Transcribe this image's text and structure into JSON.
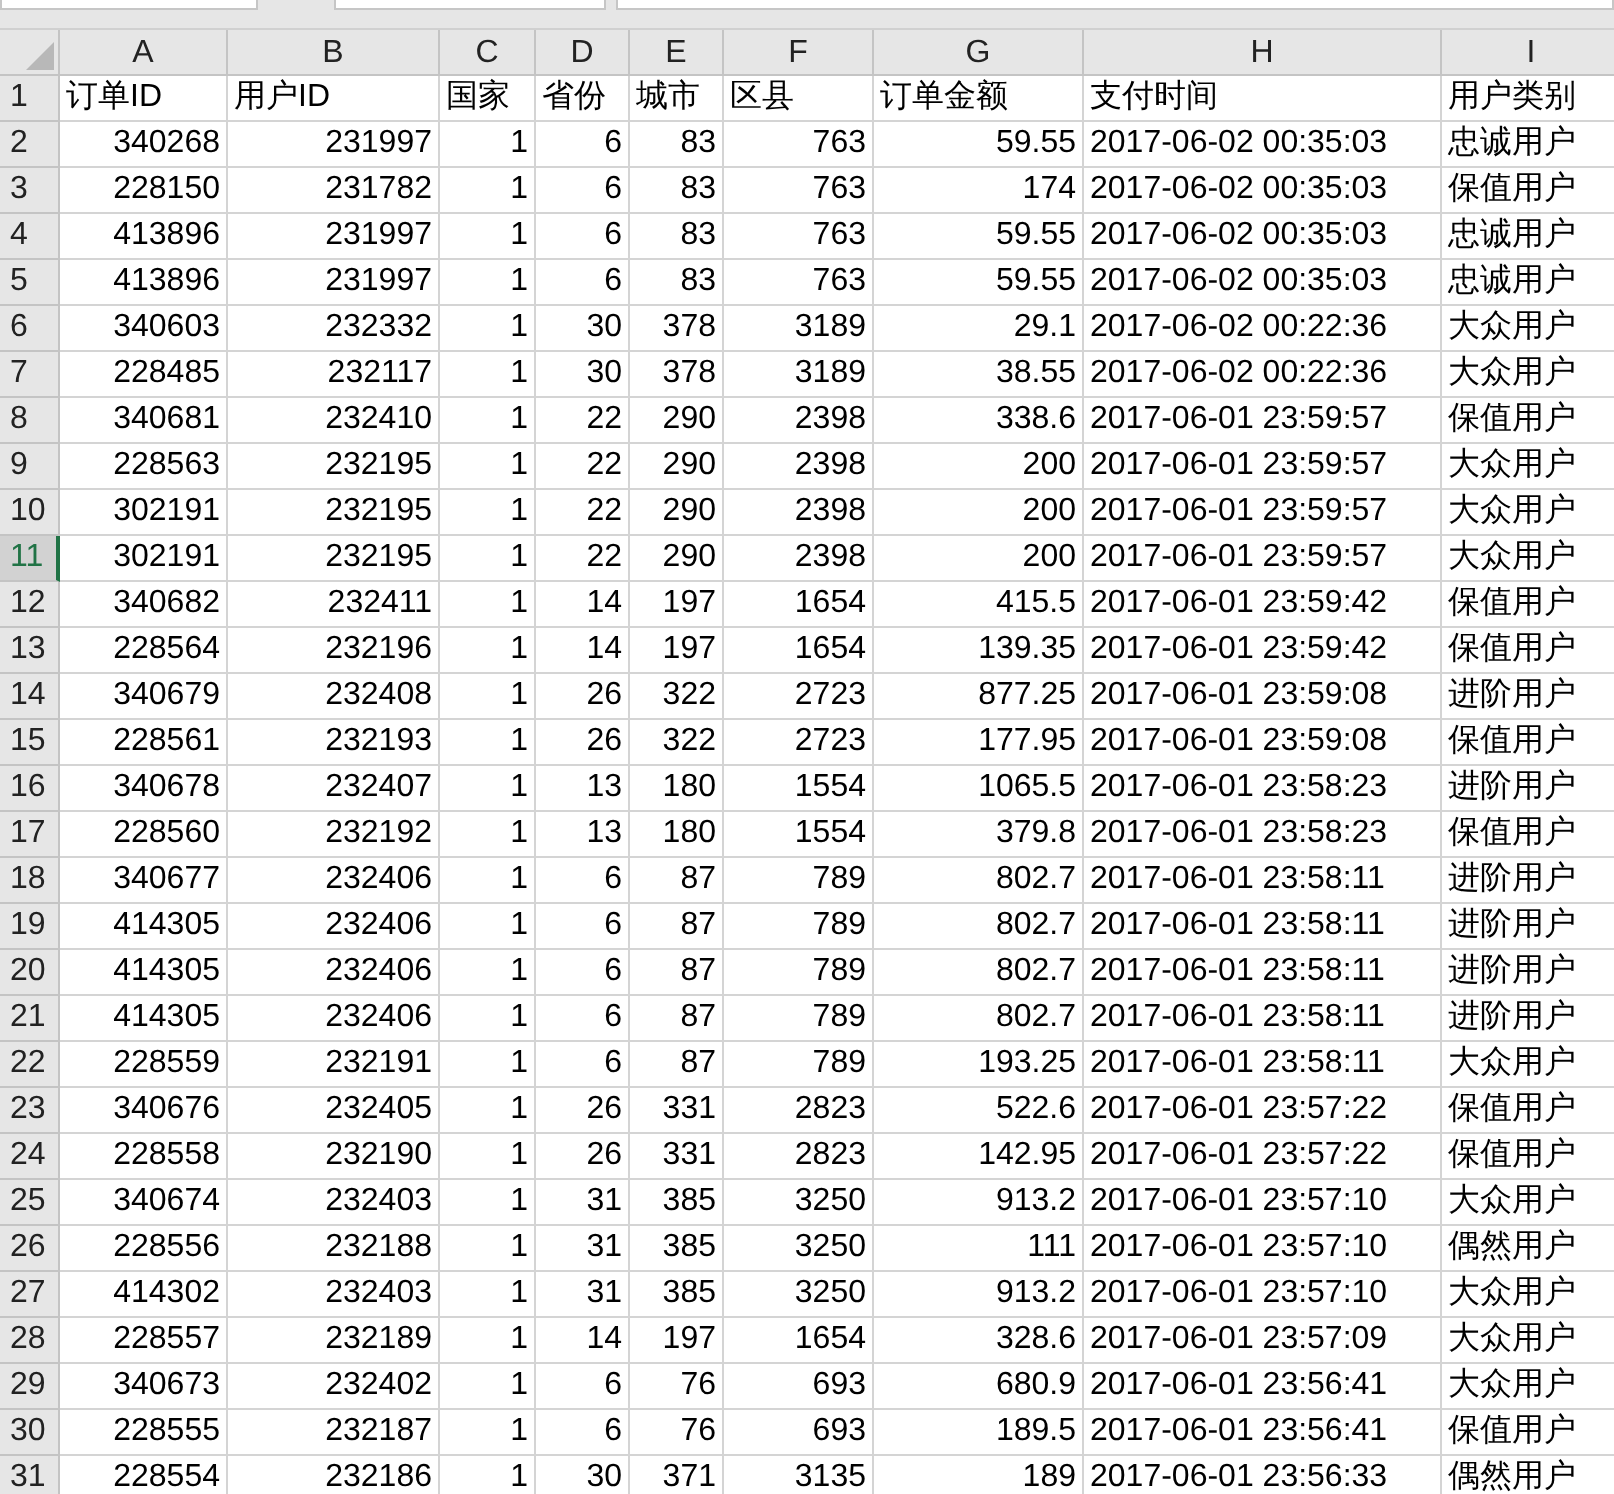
{
  "columns": [
    "A",
    "B",
    "C",
    "D",
    "E",
    "F",
    "G",
    "H",
    "I"
  ],
  "header_row": {
    "number": "1",
    "selected": false,
    "cells": [
      "订单ID",
      "用户ID",
      "国家",
      "省份",
      "城市",
      "区县",
      "订单金额",
      "支付时间",
      "用户类别"
    ]
  },
  "rows": [
    {
      "number": "2",
      "selected": false,
      "cells": [
        "340268",
        "231997",
        "1",
        "6",
        "83",
        "763",
        "59.55",
        "2017-06-02 00:35:03",
        "忠诚用户"
      ]
    },
    {
      "number": "3",
      "selected": false,
      "cells": [
        "228150",
        "231782",
        "1",
        "6",
        "83",
        "763",
        "174",
        "2017-06-02 00:35:03",
        "保值用户"
      ]
    },
    {
      "number": "4",
      "selected": false,
      "cells": [
        "413896",
        "231997",
        "1",
        "6",
        "83",
        "763",
        "59.55",
        "2017-06-02 00:35:03",
        "忠诚用户"
      ]
    },
    {
      "number": "5",
      "selected": false,
      "cells": [
        "413896",
        "231997",
        "1",
        "6",
        "83",
        "763",
        "59.55",
        "2017-06-02 00:35:03",
        "忠诚用户"
      ]
    },
    {
      "number": "6",
      "selected": false,
      "cells": [
        "340603",
        "232332",
        "1",
        "30",
        "378",
        "3189",
        "29.1",
        "2017-06-02 00:22:36",
        "大众用户"
      ]
    },
    {
      "number": "7",
      "selected": false,
      "cells": [
        "228485",
        "232117",
        "1",
        "30",
        "378",
        "3189",
        "38.55",
        "2017-06-02 00:22:36",
        "大众用户"
      ]
    },
    {
      "number": "8",
      "selected": false,
      "cells": [
        "340681",
        "232410",
        "1",
        "22",
        "290",
        "2398",
        "338.6",
        "2017-06-01 23:59:57",
        "保值用户"
      ]
    },
    {
      "number": "9",
      "selected": false,
      "cells": [
        "228563",
        "232195",
        "1",
        "22",
        "290",
        "2398",
        "200",
        "2017-06-01 23:59:57",
        "大众用户"
      ]
    },
    {
      "number": "10",
      "selected": false,
      "cells": [
        "302191",
        "232195",
        "1",
        "22",
        "290",
        "2398",
        "200",
        "2017-06-01 23:59:57",
        "大众用户"
      ]
    },
    {
      "number": "11",
      "selected": true,
      "cells": [
        "302191",
        "232195",
        "1",
        "22",
        "290",
        "2398",
        "200",
        "2017-06-01 23:59:57",
        "大众用户"
      ]
    },
    {
      "number": "12",
      "selected": false,
      "cells": [
        "340682",
        "232411",
        "1",
        "14",
        "197",
        "1654",
        "415.5",
        "2017-06-01 23:59:42",
        "保值用户"
      ]
    },
    {
      "number": "13",
      "selected": false,
      "cells": [
        "228564",
        "232196",
        "1",
        "14",
        "197",
        "1654",
        "139.35",
        "2017-06-01 23:59:42",
        "保值用户"
      ]
    },
    {
      "number": "14",
      "selected": false,
      "cells": [
        "340679",
        "232408",
        "1",
        "26",
        "322",
        "2723",
        "877.25",
        "2017-06-01 23:59:08",
        "进阶用户"
      ]
    },
    {
      "number": "15",
      "selected": false,
      "cells": [
        "228561",
        "232193",
        "1",
        "26",
        "322",
        "2723",
        "177.95",
        "2017-06-01 23:59:08",
        "保值用户"
      ]
    },
    {
      "number": "16",
      "selected": false,
      "cells": [
        "340678",
        "232407",
        "1",
        "13",
        "180",
        "1554",
        "1065.5",
        "2017-06-01 23:58:23",
        "进阶用户"
      ]
    },
    {
      "number": "17",
      "selected": false,
      "cells": [
        "228560",
        "232192",
        "1",
        "13",
        "180",
        "1554",
        "379.8",
        "2017-06-01 23:58:23",
        "保值用户"
      ]
    },
    {
      "number": "18",
      "selected": false,
      "cells": [
        "340677",
        "232406",
        "1",
        "6",
        "87",
        "789",
        "802.7",
        "2017-06-01 23:58:11",
        "进阶用户"
      ]
    },
    {
      "number": "19",
      "selected": false,
      "cells": [
        "414305",
        "232406",
        "1",
        "6",
        "87",
        "789",
        "802.7",
        "2017-06-01 23:58:11",
        "进阶用户"
      ]
    },
    {
      "number": "20",
      "selected": false,
      "cells": [
        "414305",
        "232406",
        "1",
        "6",
        "87",
        "789",
        "802.7",
        "2017-06-01 23:58:11",
        "进阶用户"
      ]
    },
    {
      "number": "21",
      "selected": false,
      "cells": [
        "414305",
        "232406",
        "1",
        "6",
        "87",
        "789",
        "802.7",
        "2017-06-01 23:58:11",
        "进阶用户"
      ]
    },
    {
      "number": "22",
      "selected": false,
      "cells": [
        "228559",
        "232191",
        "1",
        "6",
        "87",
        "789",
        "193.25",
        "2017-06-01 23:58:11",
        "大众用户"
      ]
    },
    {
      "number": "23",
      "selected": false,
      "cells": [
        "340676",
        "232405",
        "1",
        "26",
        "331",
        "2823",
        "522.6",
        "2017-06-01 23:57:22",
        "保值用户"
      ]
    },
    {
      "number": "24",
      "selected": false,
      "cells": [
        "228558",
        "232190",
        "1",
        "26",
        "331",
        "2823",
        "142.95",
        "2017-06-01 23:57:22",
        "保值用户"
      ]
    },
    {
      "number": "25",
      "selected": false,
      "cells": [
        "340674",
        "232403",
        "1",
        "31",
        "385",
        "3250",
        "913.2",
        "2017-06-01 23:57:10",
        "大众用户"
      ]
    },
    {
      "number": "26",
      "selected": false,
      "cells": [
        "228556",
        "232188",
        "1",
        "31",
        "385",
        "3250",
        "111",
        "2017-06-01 23:57:10",
        "偶然用户"
      ]
    },
    {
      "number": "27",
      "selected": false,
      "cells": [
        "414302",
        "232403",
        "1",
        "31",
        "385",
        "3250",
        "913.2",
        "2017-06-01 23:57:10",
        "大众用户"
      ]
    },
    {
      "number": "28",
      "selected": false,
      "cells": [
        "228557",
        "232189",
        "1",
        "14",
        "197",
        "1654",
        "328.6",
        "2017-06-01 23:57:09",
        "大众用户"
      ]
    },
    {
      "number": "29",
      "selected": false,
      "cells": [
        "340673",
        "232402",
        "1",
        "6",
        "76",
        "693",
        "680.9",
        "2017-06-01 23:56:41",
        "大众用户"
      ]
    },
    {
      "number": "30",
      "selected": false,
      "cells": [
        "228555",
        "232187",
        "1",
        "6",
        "76",
        "693",
        "189.5",
        "2017-06-01 23:56:41",
        "保值用户"
      ]
    },
    {
      "number": "31",
      "selected": false,
      "cells": [
        "228554",
        "232186",
        "1",
        "30",
        "371",
        "3135",
        "189",
        "2017-06-01 23:56:33",
        "偶然用户"
      ]
    }
  ]
}
